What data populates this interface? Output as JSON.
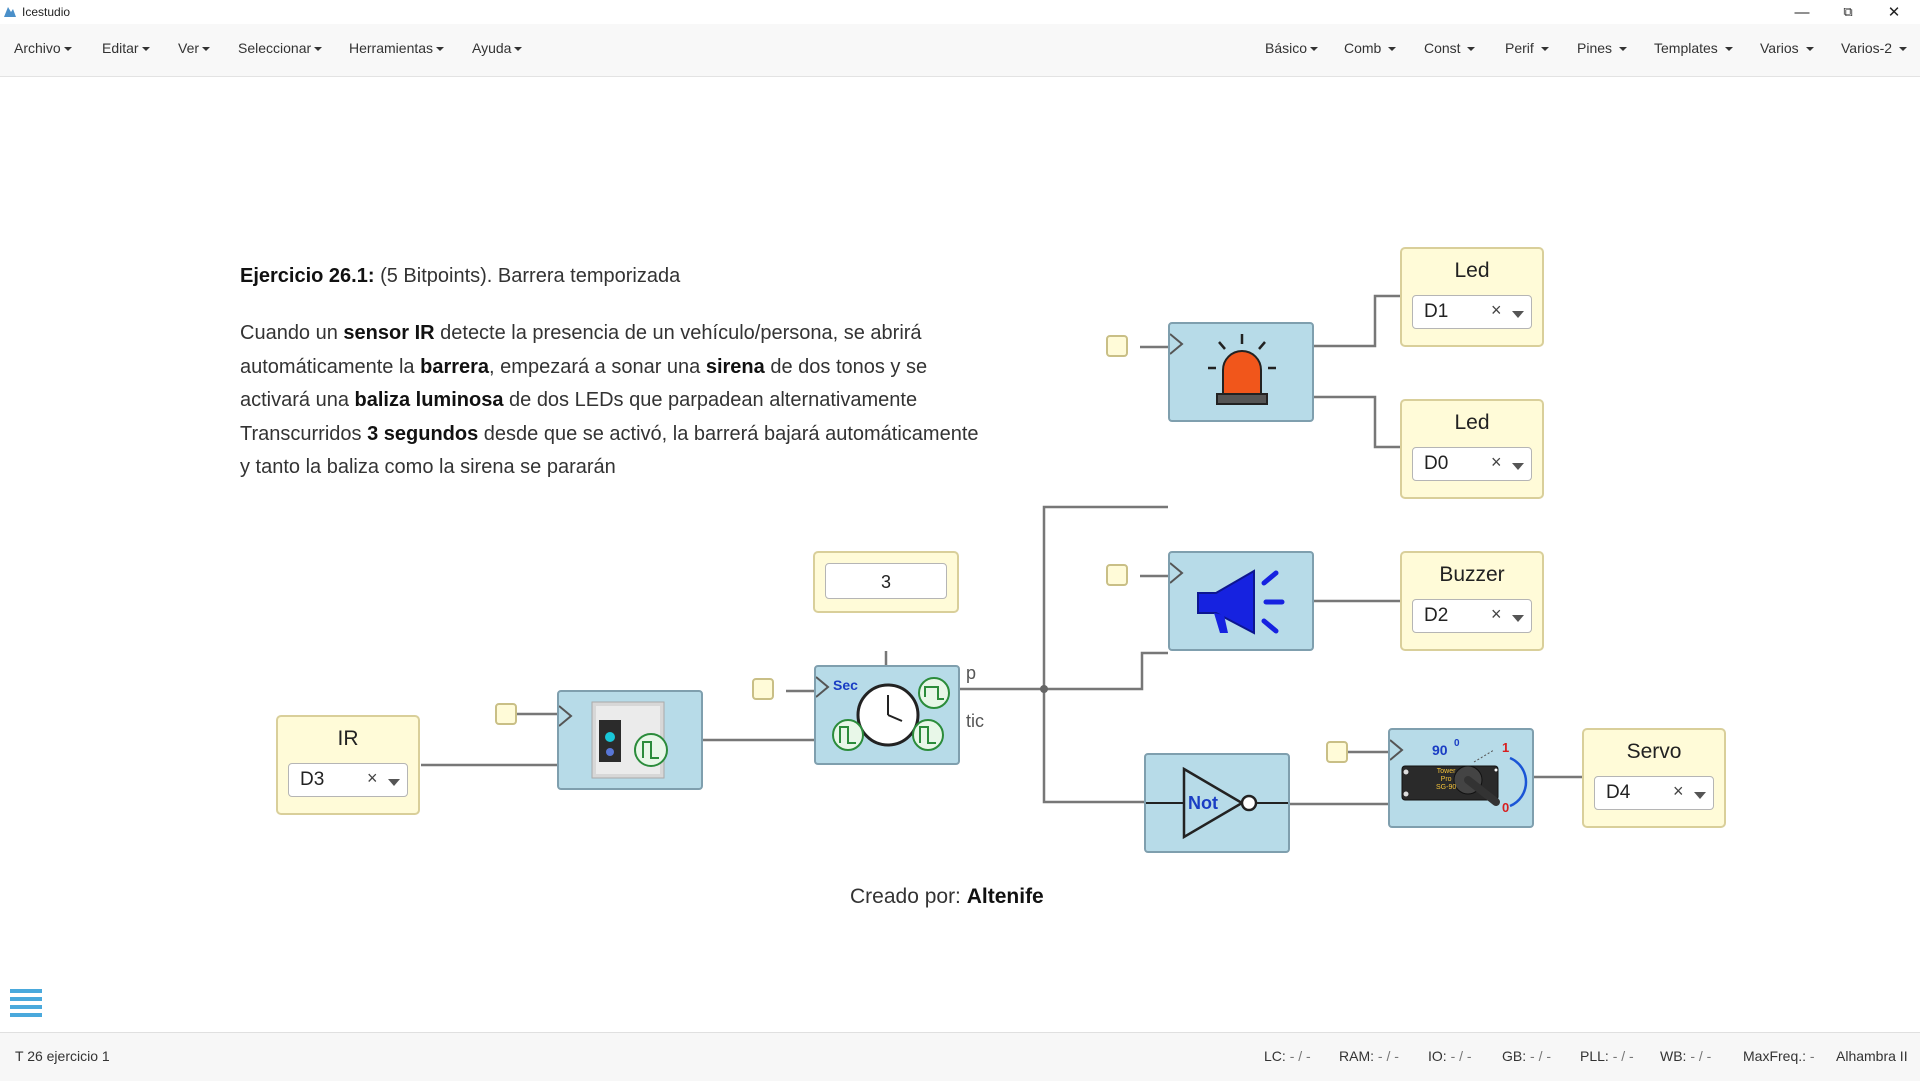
{
  "window": {
    "title": "Icestudio",
    "minimize": "—",
    "restore": "⧉",
    "close": "✕"
  },
  "menu_left": [
    "Archivo",
    "Editar",
    "Ver",
    "Seleccionar",
    "Herramientas",
    "Ayuda"
  ],
  "menu_right": [
    "Básico",
    "Comb",
    "Const",
    "Perif",
    "Pines",
    "Templates",
    "Varios",
    "Varios-2"
  ],
  "description": {
    "title_bold": "Ejercicio 26.1:",
    "title_rest": " (5 Bitpoints). Barrera temporizada",
    "l1_a": "Cuando un ",
    "l1_b": "sensor IR",
    "l1_c": " detecte la presencia de un vehículo/persona, se abrirá",
    "l2_a": "automáticamente la ",
    "l2_b": "barrera",
    "l2_c": ", empezará a sonar una ",
    "l2_d": "sirena",
    "l2_e": " de dos tonos y se",
    "l3_a": "activará una ",
    "l3_b": "baliza luminosa",
    "l3_c": " de dos LEDs que parpadean alternativamente",
    "l4_a": "Transcurridos ",
    "l4_b": "3 segundos",
    "l4_c": " desde que se activó, la barrerá bajará automáticamente",
    "l5": "y tanto la baliza como la sirena se pararán"
  },
  "credit": {
    "label": "Creado por: ",
    "author": "Altenife"
  },
  "io_blocks": {
    "ir": {
      "title": "IR",
      "pin": "D3"
    },
    "led1": {
      "title": "Led",
      "pin": "D1"
    },
    "led2": {
      "title": "Led",
      "pin": "D0"
    },
    "buzzer": {
      "title": "Buzzer",
      "pin": "D2"
    },
    "servo": {
      "title": "Servo",
      "pin": "D4"
    }
  },
  "clear_symbol": "×",
  "timer_constant": "3",
  "timer": {
    "label": "Sec",
    "out_p": "p",
    "out_tic": "tic"
  },
  "not_gate": {
    "label": "Not"
  },
  "servo_icon": {
    "angle": "90",
    "deg": "0",
    "max": "1",
    "min": "0",
    "text1": "Tower",
    "text2": "Pro",
    "text3": "SG-90"
  },
  "status": {
    "file": "T 26 ejercicio 1",
    "lc": "LC:",
    "lc_v": "- / -",
    "ram": "RAM:",
    "ram_v": "- / -",
    "io": "IO:",
    "io_v": "- / -",
    "gb": "GB:",
    "gb_v": "- / -",
    "pll": "PLL:",
    "pll_v": "- / -",
    "wb": "WB:",
    "wb_v": "- / -",
    "maxfreq": "MaxFreq.:",
    "maxfreq_v": "-",
    "board": "Alhambra II"
  }
}
